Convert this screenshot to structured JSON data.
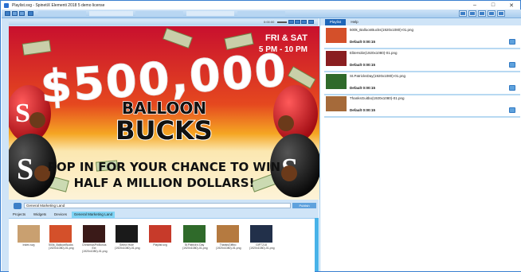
{
  "window": {
    "title": "Playlist.svg - SpinetiX Elementi 2018 5 demo license",
    "controls": {
      "minimize": "–",
      "maximize": "□",
      "close": "✕"
    }
  },
  "preview": {
    "time": "0:00:00",
    "poster": {
      "date_line1": "FRI & SAT",
      "date_line2": "5 PM - 10 PM",
      "amount": "$500,000",
      "word1": "BALLOON",
      "word2": "BUCKS",
      "tagline1": "POP IN FOR YOUR CHANCE TO WIN",
      "tagline2": "HALF A MILLION DOLLARS!",
      "logo_letter": "S"
    }
  },
  "address": {
    "value": "General Marketing Land",
    "publish_label": "Publish"
  },
  "tabs": [
    {
      "label": "Projects"
    },
    {
      "label": "Widgets"
    },
    {
      "label": "Devices"
    },
    {
      "label": "General Marketing Land"
    }
  ],
  "files": [
    {
      "label": "Index.svg",
      "color": "#c9a070"
    },
    {
      "label": "500k_BalloonBucks (1920x1080)-01.png",
      "color": "#d4502a"
    },
    {
      "label": "ChristmasPixBonus Ext (1920x1080)-01.png",
      "color": "#3a1a18"
    },
    {
      "label": "Select Hole (1920x1080)-01.png",
      "color": "#1a1a1a"
    },
    {
      "label": "Playlist.svg",
      "color": "#c73a2a"
    },
    {
      "label": "St.Patrick's Day (1920x1080)-01.png",
      "color": "#2f6a2a"
    },
    {
      "label": "ThanksGiftbo (1920x1080)-01.png",
      "color": "#b57a40"
    },
    {
      "label": "GIFT218 (1920x1080)-01.png",
      "color": "#22304a"
    }
  ],
  "right_tabs": [
    {
      "label": "Playlist"
    },
    {
      "label": "Help"
    }
  ],
  "playlist": [
    {
      "name": "500k_BalloonBucks(1920x1080)-01.png",
      "duration": "Default 0:00:15",
      "color": "#d4502a"
    },
    {
      "name": "EliteHolie(1920x1080)-01.png",
      "duration": "Default 0:00:15",
      "color": "#8a1e20"
    },
    {
      "name": "St.PatricksDay(1920x1080)-01.png",
      "duration": "Default 0:00:15",
      "color": "#2f6a2a"
    },
    {
      "name": "ThanksGuitbo(1920x1080)-01.png",
      "duration": "Default 0:00:15",
      "color": "#a56a3a"
    }
  ],
  "colors": {
    "accent": "#1e66b8",
    "toolbar": "#a9cdee",
    "scrollbar": "#48b2e8"
  }
}
